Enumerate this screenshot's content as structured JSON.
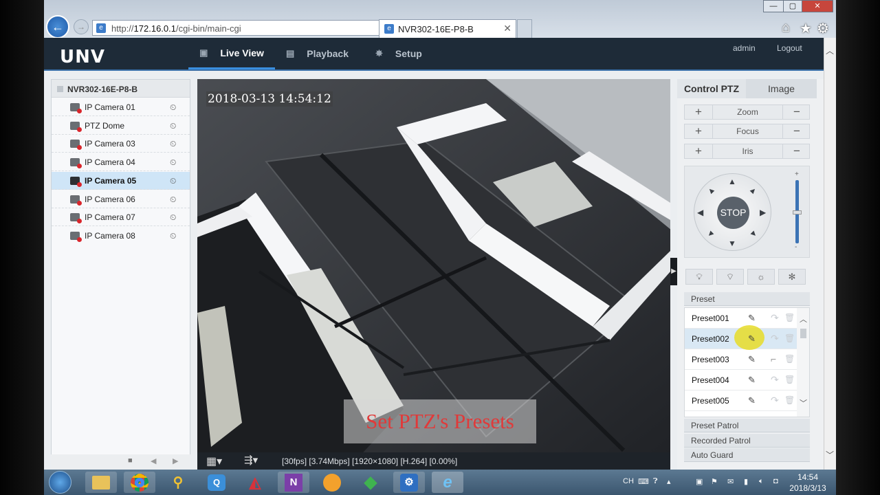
{
  "browser": {
    "url_host": "172.16.0.1",
    "url_prefix": "http://",
    "url_path": "/cgi-bin/main-cgi",
    "tab_title": "NVR302-16E-P8-B",
    "tab_close": "✕",
    "win_min": "—",
    "win_max": "▢",
    "win_close": "✕",
    "icons": [
      "back-icon",
      "forward-icon",
      "search-icon",
      "refresh-icon",
      "home-icon",
      "favorites-icon",
      "settings-icon"
    ]
  },
  "app": {
    "logo": "UNV",
    "nav": [
      {
        "label": "Live View",
        "icon": "monitor-icon"
      },
      {
        "label": "Playback",
        "icon": "film-icon"
      },
      {
        "label": "Setup",
        "icon": "gear-icon"
      }
    ],
    "active_nav": "Live View",
    "user": "admin",
    "logout": "Logout"
  },
  "device_tree": {
    "root": "NVR302-16E-P8-B",
    "cameras": [
      "IP Camera 01",
      "PTZ Dome",
      "IP Camera 03",
      "IP Camera 04",
      "IP Camera 05",
      "IP Camera 06",
      "IP Camera 07",
      "IP Camera 08"
    ],
    "selected": "IP Camera 05"
  },
  "video": {
    "osd_timestamp": "2018-03-13 14:54:12",
    "caption": "Set PTZ's Presets",
    "status": "[30fps] [3.74Mbps] [1920×1080] [H.264] [0.00%]"
  },
  "ptz": {
    "tab_control": "Control PTZ",
    "tab_image": "Image",
    "zoom": "Zoom",
    "focus": "Focus",
    "iris": "Iris",
    "plus": "+",
    "minus": "−",
    "stop": "STOP",
    "slider_plus": "+",
    "slider_minus": "-",
    "preset_header": "Preset",
    "presets": [
      "Preset001",
      "Preset002",
      "Preset003",
      "Preset004",
      "Preset005"
    ],
    "highlighted_preset": "Preset002",
    "preset_patrol": "Preset Patrol",
    "recorded_patrol": "Recorded Patrol",
    "auto_guard": "Auto Guard"
  },
  "taskbar": {
    "lang": "CH",
    "time": "14:54",
    "date": "2018/3/13",
    "apps": [
      "folder-icon",
      "chrome-icon",
      "search-tool-icon",
      "qq-icon",
      "mail-icon",
      "onenote-icon",
      "orange-app-icon",
      "green-app-icon",
      "settings-app-icon",
      "ie-icon"
    ]
  },
  "colors": {
    "header_bg": "#1e2b38",
    "accent": "#3a8fe0",
    "selected_row": "#cfe5f7",
    "caption_text": "#e03a3a"
  }
}
